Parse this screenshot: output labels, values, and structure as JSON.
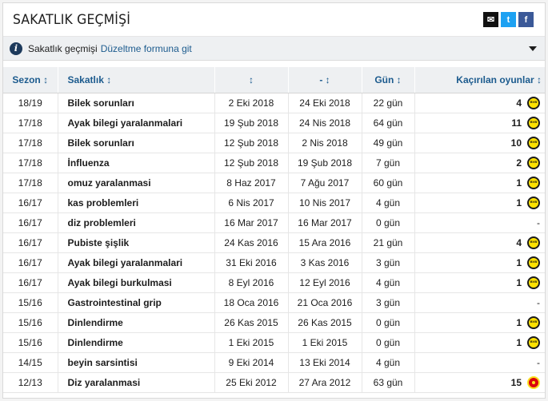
{
  "title": "SAKATLIK GEÇMİŞİ",
  "share": {
    "mail": "✉",
    "twitter": "t",
    "facebook": "f"
  },
  "info": {
    "text": "Sakatlık geçmişi",
    "link": "Düzeltme formuna git"
  },
  "columns": [
    "Sezon ↕",
    "Sakatlık ↕",
    "↕",
    "- ↕",
    "Gün ↕",
    "Kaçırılan oyunlar ↕"
  ],
  "rows": [
    {
      "season": "18/19",
      "injury": "Bilek sorunları",
      "from": "2 Eki 2018",
      "until": "24 Eki 2018",
      "days": "22 gün",
      "games": "4",
      "club": "bvb-crest-icon"
    },
    {
      "season": "17/18",
      "injury": "Ayak bilegi yaralanmalari",
      "from": "19 Şub 2018",
      "until": "24 Nis 2018",
      "days": "64 gün",
      "games": "11",
      "club": "bvb-crest-icon"
    },
    {
      "season": "17/18",
      "injury": "Bilek sorunları",
      "from": "12 Şub 2018",
      "until": "2 Nis 2018",
      "days": "49 gün",
      "games": "10",
      "club": "bvb-crest-icon"
    },
    {
      "season": "17/18",
      "injury": "İnfluenza",
      "from": "12 Şub 2018",
      "until": "19 Şub 2018",
      "days": "7 gün",
      "games": "2",
      "club": "bvb-crest-icon"
    },
    {
      "season": "17/18",
      "injury": "omuz yaralanmasi",
      "from": "8 Haz 2017",
      "until": "7 Ağu 2017",
      "days": "60 gün",
      "games": "1",
      "club": "bvb-crest-icon"
    },
    {
      "season": "16/17",
      "injury": "kas problemleri",
      "from": "6 Nis 2017",
      "until": "10 Nis 2017",
      "days": "4 gün",
      "games": "1",
      "club": "bvb-crest-icon"
    },
    {
      "season": "16/17",
      "injury": "diz problemleri",
      "from": "16 Mar 2017",
      "until": "16 Mar 2017",
      "days": "0 gün",
      "games": "-",
      "club": ""
    },
    {
      "season": "16/17",
      "injury": "Pubiste şişlik",
      "from": "24 Kas 2016",
      "until": "15 Ara 2016",
      "days": "21 gün",
      "games": "4",
      "club": "bvb-crest-icon"
    },
    {
      "season": "16/17",
      "injury": "Ayak bilegi yaralanmalari",
      "from": "31 Eki 2016",
      "until": "3 Kas 2016",
      "days": "3 gün",
      "games": "1",
      "club": "bvb-crest-icon"
    },
    {
      "season": "16/17",
      "injury": "Ayak bilegi burkulmasi",
      "from": "8 Eyl 2016",
      "until": "12 Eyl 2016",
      "days": "4 gün",
      "games": "1",
      "club": "bvb-crest-icon"
    },
    {
      "season": "15/16",
      "injury": "Gastrointestinal grip",
      "from": "18 Oca 2016",
      "until": "21 Oca 2016",
      "days": "3 gün",
      "games": "-",
      "club": ""
    },
    {
      "season": "15/16",
      "injury": "Dinlendirme",
      "from": "26 Kas 2015",
      "until": "26 Kas 2015",
      "days": "0 gün",
      "games": "1",
      "club": "bvb-crest-icon"
    },
    {
      "season": "15/16",
      "injury": "Dinlendirme",
      "from": "1 Eki 2015",
      "until": "1 Eki 2015",
      "days": "0 gün",
      "games": "1",
      "club": "bvb-crest-icon"
    },
    {
      "season": "14/15",
      "injury": "beyin sarsintisi",
      "from": "9 Eki 2014",
      "until": "13 Eki 2014",
      "days": "4 gün",
      "games": "-",
      "club": ""
    },
    {
      "season": "12/13",
      "injury": "Diz yaralanmasi",
      "from": "25 Eki 2012",
      "until": "27 Ara 2012",
      "days": "63 gün",
      "games": "15",
      "club": "man-utd-crest-icon"
    }
  ]
}
